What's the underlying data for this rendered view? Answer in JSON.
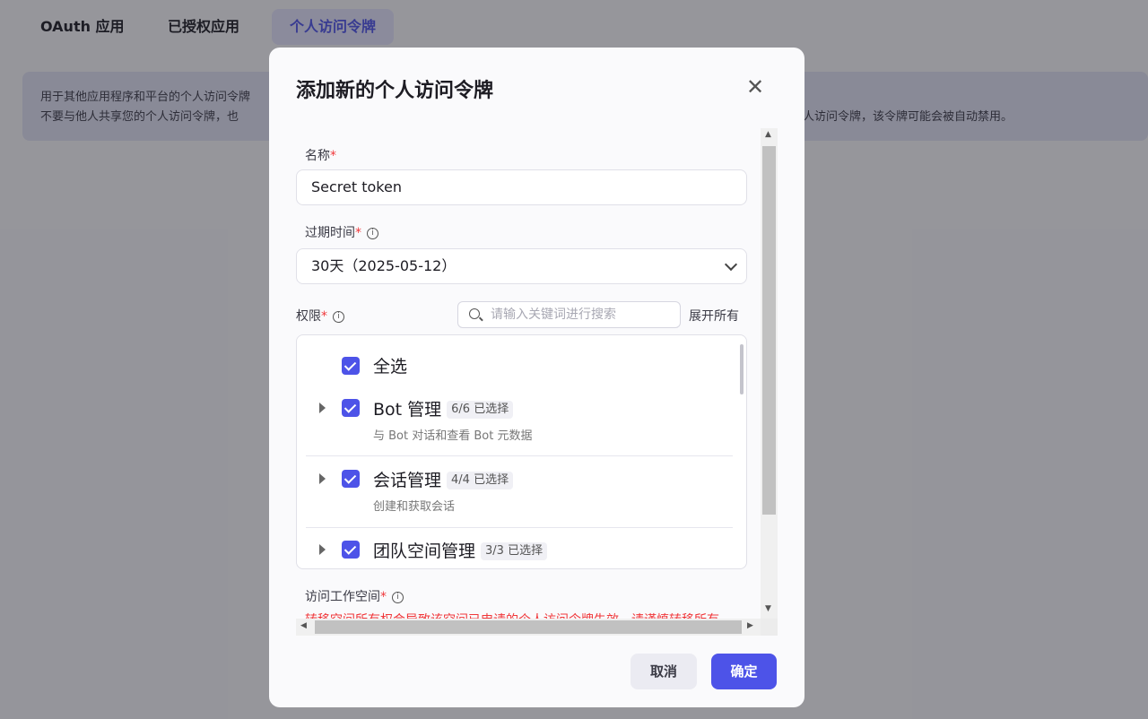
{
  "page": {
    "tabs": [
      {
        "label": "OAuth 应用"
      },
      {
        "label": "已授权应用"
      },
      {
        "label": "个人访问令牌"
      }
    ],
    "banner": {
      "line1": "用于其他应用程序和平台的个人访问令牌",
      "line2_start": "不要与他人共享您的个人访问令牌，也",
      "line2_end": "露的个人访问令牌，该令牌可能会被自动禁用。"
    }
  },
  "modal": {
    "title": "添加新的个人访问令牌",
    "close_icon": "close-icon",
    "name": {
      "label": "名称",
      "value": "Secret token"
    },
    "expiry": {
      "label": "过期时间",
      "value": "30天（2025-05-12）"
    },
    "permissions": {
      "label": "权限",
      "search_placeholder": "请输入关键词进行搜索",
      "expand_all": "展开所有",
      "select_all": "全选",
      "groups": [
        {
          "title": "Bot 管理",
          "badge": "6/6 已选择",
          "desc": "与 Bot 对话和查看 Bot 元数据"
        },
        {
          "title": "会话管理",
          "badge": "4/4 已选择",
          "desc": "创建和获取会话"
        },
        {
          "title": "团队空间管理",
          "badge": "3/3 已选择"
        }
      ]
    },
    "workspace": {
      "label": "访问工作空间",
      "warning": "转移空间所有权会导致该空间已申请的个人访问令牌失效，请谨慎转移所有"
    },
    "cancel": "取消",
    "confirm": "确定",
    "accent": "#4d53e8"
  }
}
